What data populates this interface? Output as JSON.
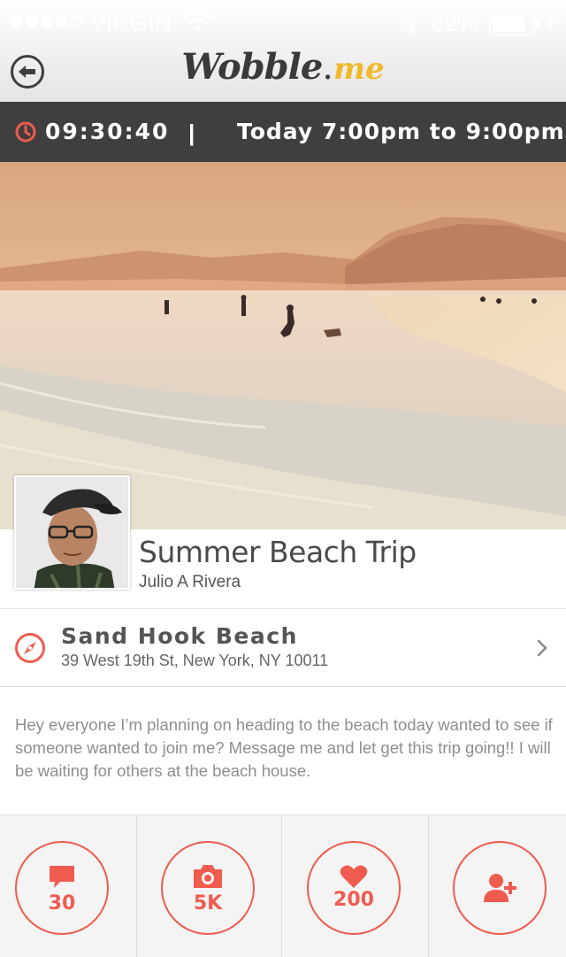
{
  "status_bar": {
    "signal_filled": 4,
    "signal_total": 5,
    "carrier": "VIRGIN",
    "battery_percent": "82%",
    "battery_level": 0.82
  },
  "nav": {
    "back_icon": "back-arrow-icon",
    "logo_main": "Wobble",
    "logo_dot": ".",
    "logo_me": "me"
  },
  "timebar": {
    "countdown": "09:30:40",
    "separator": "|",
    "event_time": "Today 7:00pm to 9:00pm"
  },
  "event": {
    "title": "Summer Beach Trip",
    "host": "Julio A Rivera"
  },
  "location": {
    "name": "Sand Hook Beach",
    "address": "39 West 19th St, New York, NY 10011"
  },
  "description": "Hey everyone I’m planning on heading to the beach today wanted to see if someone wanted to join me? Message me and let get this trip going!! I will be waiting for others at the beach house.",
  "actions": [
    {
      "icon": "comment-icon",
      "count": "30"
    },
    {
      "icon": "camera-icon",
      "count": "5K"
    },
    {
      "icon": "heart-icon",
      "count": "200"
    },
    {
      "icon": "add-friend-icon",
      "count": ""
    }
  ],
  "colors": {
    "accent": "#f05b4f",
    "dark_bar": "#3f3f3f",
    "logo_yellow": "#f1b829"
  }
}
